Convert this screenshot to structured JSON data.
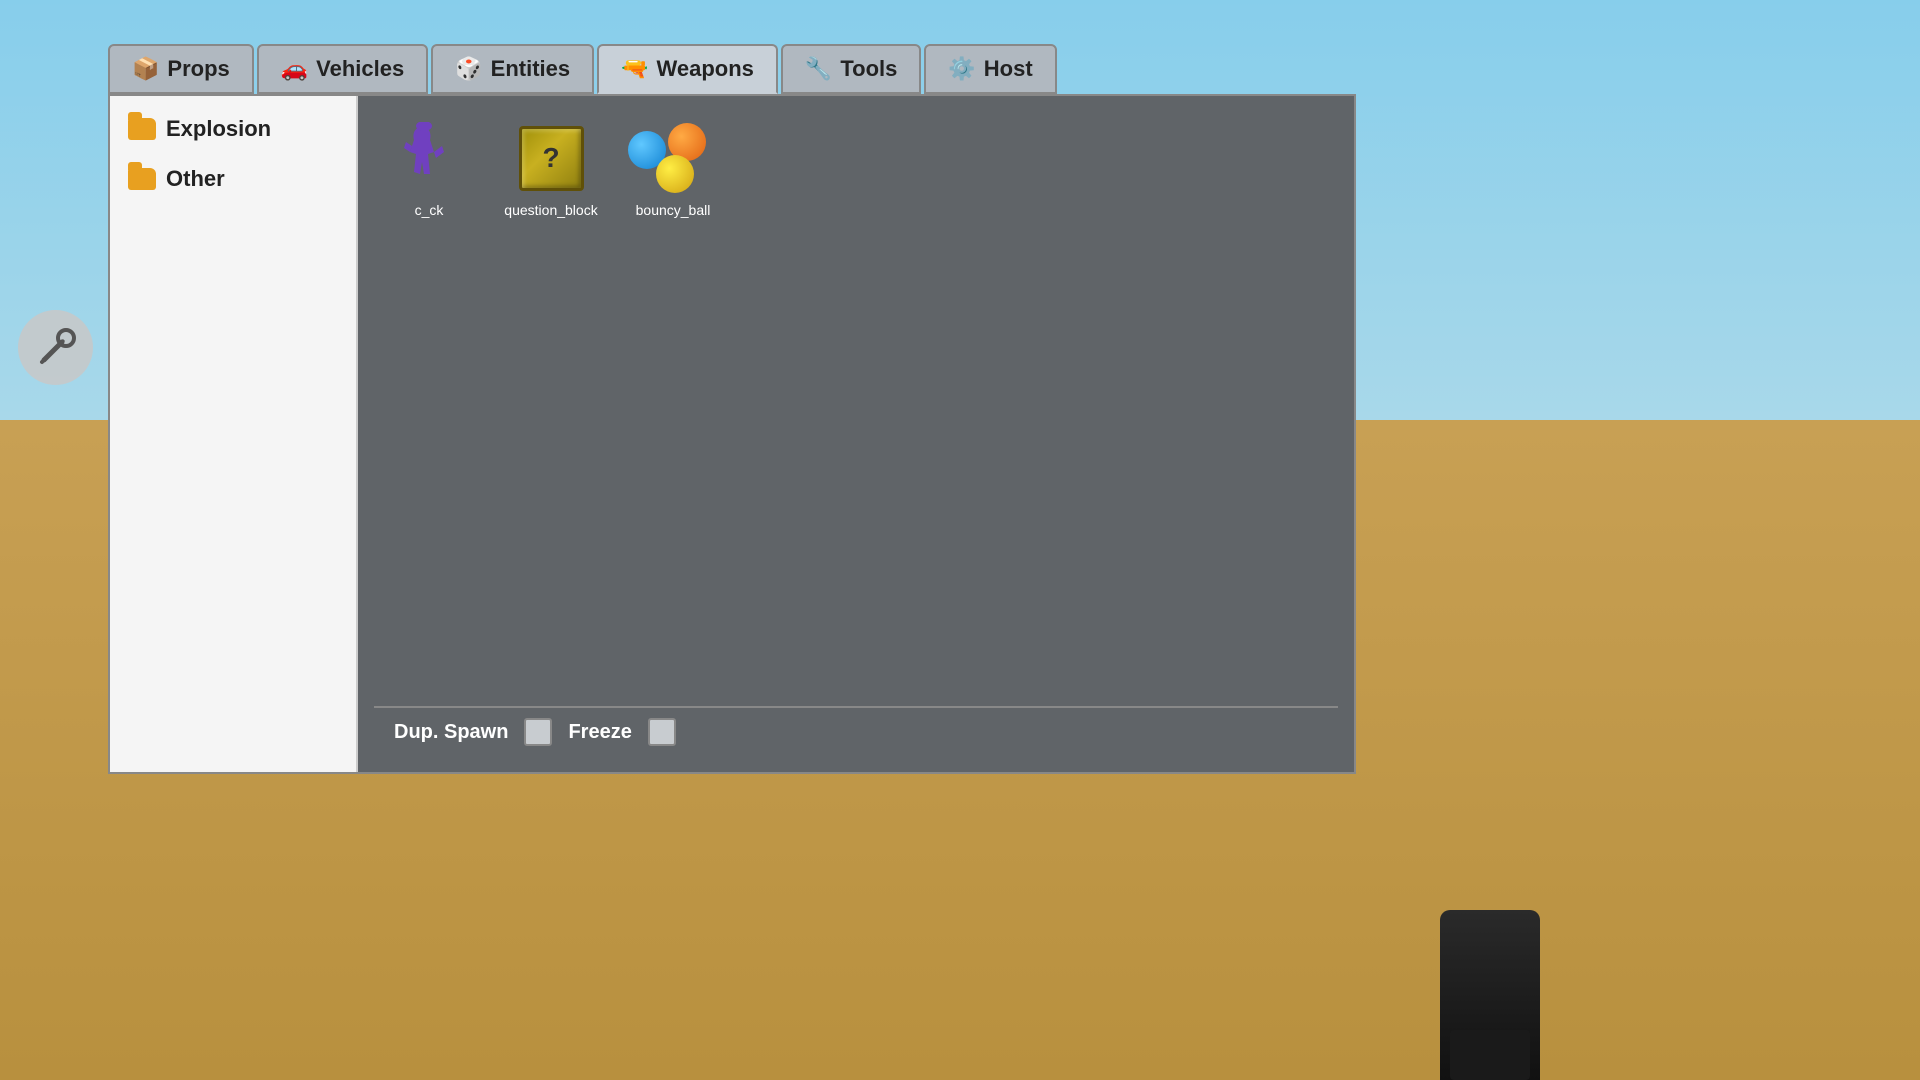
{
  "background": {
    "sky_color": "#87ceeb",
    "ground_color": "#b8903e"
  },
  "tabs": [
    {
      "id": "props",
      "label": "Props",
      "icon": "📦",
      "active": false
    },
    {
      "id": "vehicles",
      "label": "Vehicles",
      "icon": "🚗",
      "active": false
    },
    {
      "id": "entities",
      "label": "Entities",
      "icon": "🎲",
      "active": false
    },
    {
      "id": "weapons",
      "label": "Weapons",
      "icon": "🔫",
      "active": true
    },
    {
      "id": "tools",
      "label": "Tools",
      "icon": "🔧",
      "active": false
    },
    {
      "id": "host",
      "label": "Host",
      "icon": "⚙️",
      "active": false
    }
  ],
  "sidebar": {
    "categories": [
      {
        "id": "explosion",
        "label": "Explosion"
      },
      {
        "id": "other",
        "label": "Other"
      }
    ]
  },
  "items": [
    {
      "id": "c_ck",
      "label": "c_ck",
      "type": "purple_figure"
    },
    {
      "id": "question_block",
      "label": "question_block",
      "type": "question_block"
    },
    {
      "id": "bouncy_ball",
      "label": "bouncy_ball",
      "type": "bouncy_ball"
    }
  ],
  "bottom_bar": {
    "dup_spawn_label": "Dup. Spawn",
    "freeze_label": "Freeze"
  }
}
